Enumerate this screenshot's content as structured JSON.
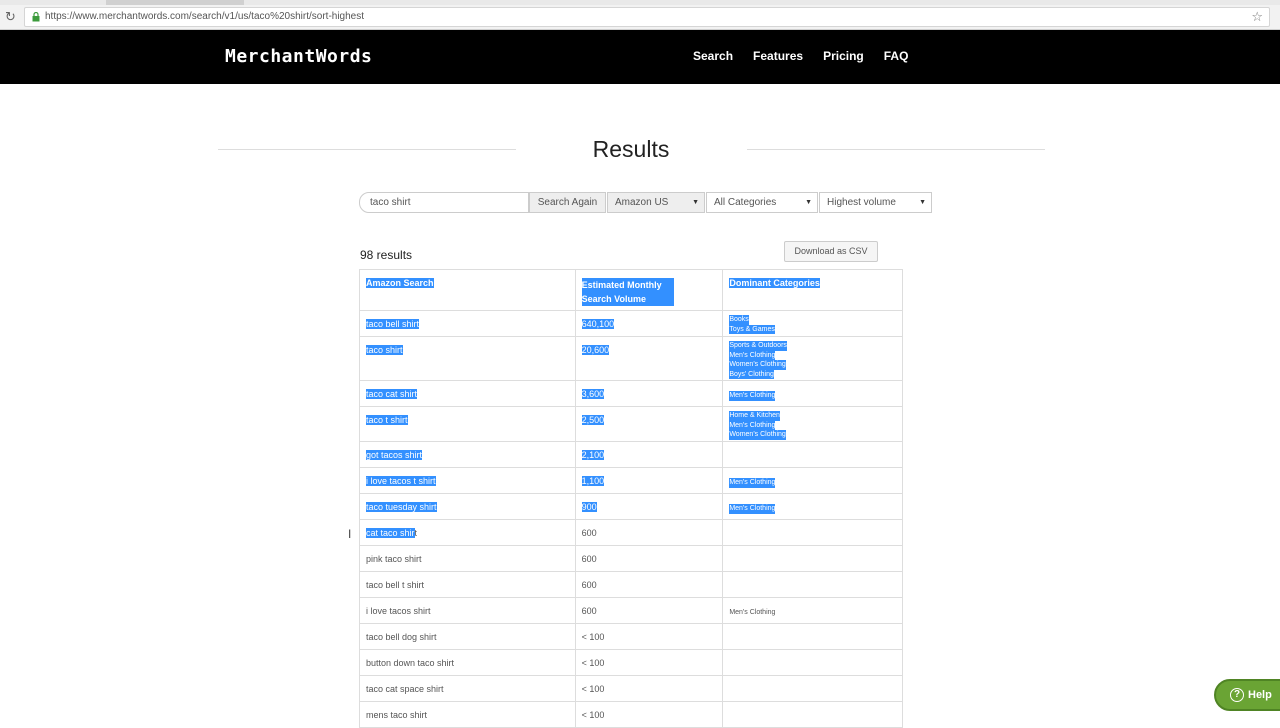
{
  "browser": {
    "url": "https://www.merchantwords.com/search/v1/us/taco%20shirt/sort-highest"
  },
  "navbar": {
    "logo": "MerchantWords",
    "links": [
      "Search",
      "Features",
      "Pricing",
      "FAQ"
    ]
  },
  "heading": "Results",
  "search": {
    "value": "taco shirt",
    "button": "Search Again",
    "marketplace": "Amazon US",
    "category": "All Categories",
    "sort": "Highest volume"
  },
  "results": {
    "count_label": "98 results",
    "download_label": "Download as CSV",
    "headers": [
      "Amazon Search",
      "Estimated Monthly Search Volume",
      "Dominant Categories"
    ],
    "rows": [
      {
        "term": "taco bell shirt",
        "volume": "640,100",
        "categories": [
          "Books",
          "Toys & Games"
        ],
        "selected": true
      },
      {
        "term": "taco shirt",
        "volume": "20,600",
        "categories": [
          "Sports & Outdoors",
          "Men's Clothing",
          "Women's Clothing",
          "Boys' Clothing"
        ],
        "selected": true
      },
      {
        "term": "taco cat shirt",
        "volume": "3,600",
        "categories": [
          "Men's Clothing"
        ],
        "selected": true
      },
      {
        "term": "taco t shirt",
        "volume": "2,500",
        "categories": [
          "Home & Kitchen",
          "Men's Clothing",
          "Women's Clothing"
        ],
        "selected": true
      },
      {
        "term": "got tacos shirt",
        "volume": "2,100",
        "categories": [],
        "selected": true
      },
      {
        "term": "i love tacos t shirt",
        "volume": "1,100",
        "categories": [
          "Men's Clothing"
        ],
        "selected": true
      },
      {
        "term": "taco tuesday shirt",
        "volume": "900",
        "categories": [
          "Men's Clothing"
        ],
        "selected": true
      },
      {
        "term": "cat taco shirt",
        "volume": "600",
        "categories": [],
        "selected": "partial"
      },
      {
        "term": "pink taco shirt",
        "volume": "600",
        "categories": [],
        "selected": false
      },
      {
        "term": "taco bell t shirt",
        "volume": "600",
        "categories": [],
        "selected": false
      },
      {
        "term": "i love tacos shirt",
        "volume": "600",
        "categories": [
          "Men's Clothing"
        ],
        "selected": false
      },
      {
        "term": "taco bell dog shirt",
        "volume": "< 100",
        "categories": [],
        "selected": false
      },
      {
        "term": "button down taco shirt",
        "volume": "< 100",
        "categories": [],
        "selected": false
      },
      {
        "term": "taco cat space shirt",
        "volume": "< 100",
        "categories": [],
        "selected": false
      },
      {
        "term": "mens taco shirt",
        "volume": "< 100",
        "categories": [],
        "selected": false
      }
    ]
  },
  "help": {
    "label": "Help"
  }
}
